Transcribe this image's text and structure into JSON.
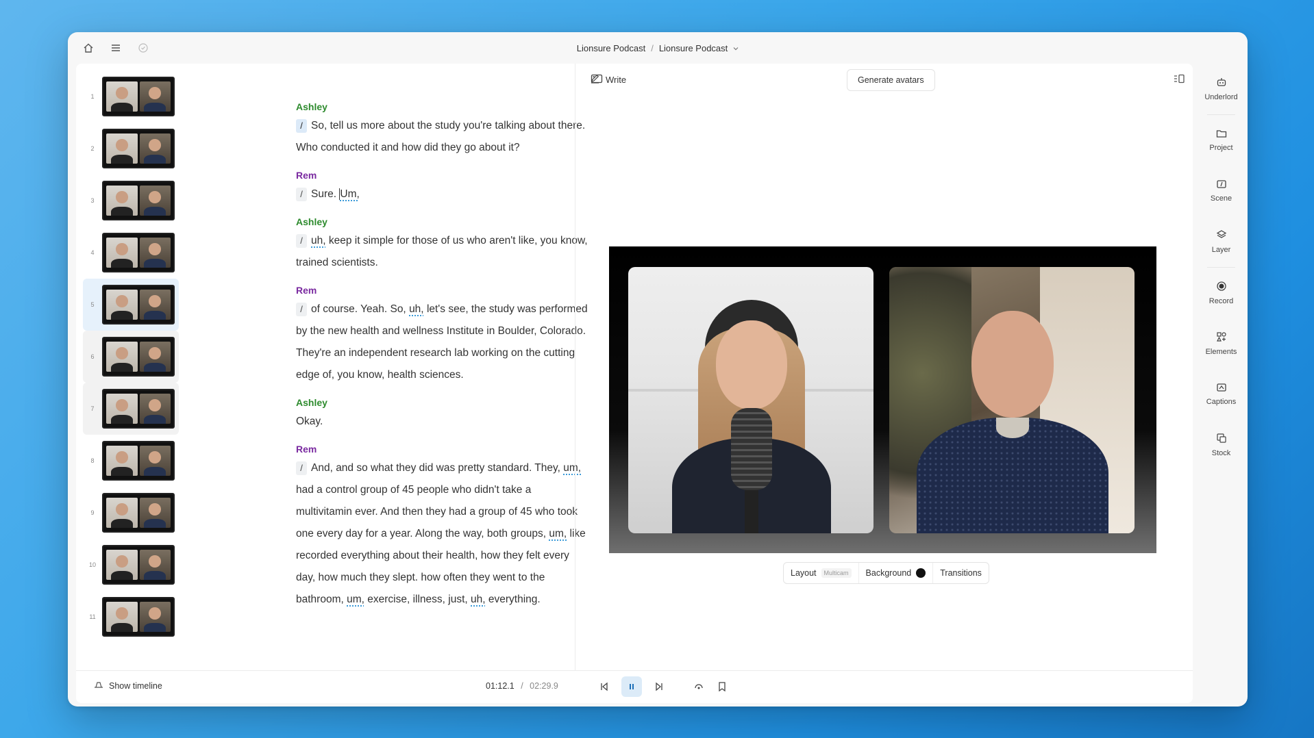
{
  "breadcrumb": {
    "project": "Lionsure Podcast",
    "composition": "Lionsure Podcast"
  },
  "toolbar": {
    "write_label": "Write",
    "generate_label": "Generate avatars"
  },
  "scenes": [
    {
      "num": "1"
    },
    {
      "num": "2"
    },
    {
      "num": "3"
    },
    {
      "num": "4"
    },
    {
      "num": "5"
    },
    {
      "num": "6"
    },
    {
      "num": "7"
    },
    {
      "num": "8"
    },
    {
      "num": "9"
    },
    {
      "num": "10"
    },
    {
      "num": "11"
    }
  ],
  "transcript": {
    "b1": {
      "speaker": "Ashley",
      "l1": "So, tell us more about the study you're talking about there.",
      "l2": "Who conducted it and how did they go about it?"
    },
    "b2": {
      "speaker": "Rem",
      "t1": "Sure.",
      "t2": "Um,"
    },
    "b3": {
      "speaker": "Ashley",
      "f1": "uh,",
      "t1": "keep it simple for those of us who aren't like, you know,",
      "l2": "trained scientists."
    },
    "b4": {
      "speaker": "Rem",
      "t1": "of course. Yeah. So,",
      "f1": "uh,",
      "t2": "let's see, the study was performed",
      "l2": "by the new health and wellness Institute in Boulder, Colorado.",
      "l3": "They're an independent research lab working on the cutting",
      "l4": "edge of, you know, health sciences."
    },
    "b5": {
      "speaker": "Ashley",
      "l1": "Okay."
    },
    "b6": {
      "speaker": "Rem",
      "t1": "And, and so what they did was pretty standard. They,",
      "f1": "um,",
      "l2": "had a control group of 45 people who didn't take a",
      "l3": "multivitamin ever. And then they had a group of 45 who took",
      "t4": "one every day for a year. Along the way, both groups,",
      "f4": "um,",
      "t4b": "like",
      "l5": "recorded everything about their health, how they felt every",
      "l6": "day, how much they slept. how often they went to the",
      "t7": "bathroom,",
      "f7a": "um,",
      "t7b": "exercise, illness, just,",
      "f7b": "uh,",
      "t7c": "everything."
    }
  },
  "stage": {
    "layout_label": "Layout",
    "layout_value": "Multicam",
    "background_label": "Background",
    "background_color": "#111111",
    "transitions_label": "Transitions"
  },
  "playback": {
    "current": "01:12.1",
    "sep": "/",
    "total": "02:29.9",
    "show_timeline": "Show timeline"
  },
  "rail": {
    "underlord": "Underlord",
    "project": "Project",
    "scene": "Scene",
    "layer": "Layer",
    "record": "Record",
    "elements": "Elements",
    "captions": "Captions",
    "stock": "Stock"
  }
}
